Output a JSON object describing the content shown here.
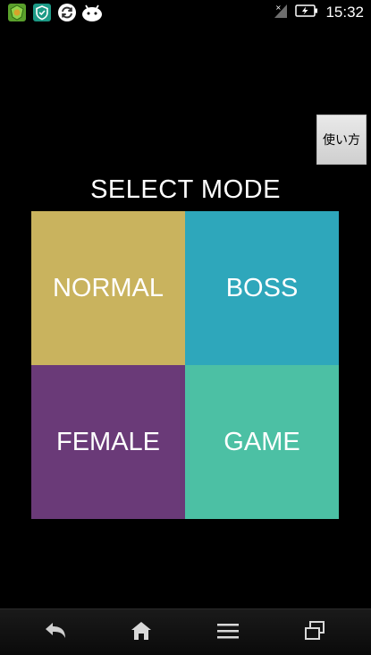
{
  "status_bar": {
    "time": "15:32",
    "notification_icons": [
      "green-shield-app-icon",
      "shield-check-icon",
      "sync-icon",
      "android-icon"
    ],
    "system_icons": [
      "no-signal-icon",
      "battery-charging-icon"
    ]
  },
  "help_button": {
    "label": "使い方"
  },
  "title": "SELECT MODE",
  "modes": [
    {
      "label": "NORMAL",
      "color": "#c9b35e"
    },
    {
      "label": "BOSS",
      "color": "#2ea7bb"
    },
    {
      "label": "FEMALE",
      "color": "#6a3a78"
    },
    {
      "label": "GAME",
      "color": "#4cc0a4"
    }
  ],
  "nav_bar": {
    "buttons": [
      "back-icon",
      "home-icon",
      "menu-icon",
      "recent-apps-icon"
    ]
  }
}
